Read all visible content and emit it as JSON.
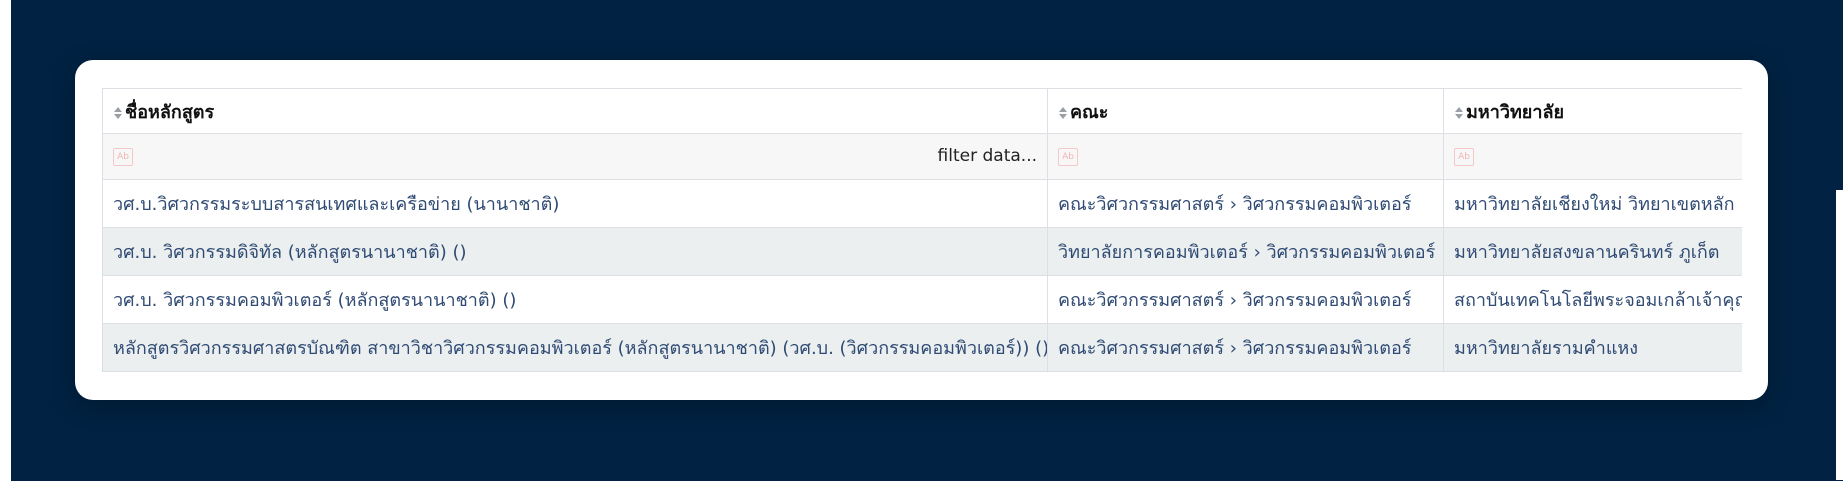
{
  "table": {
    "columns": [
      "ชื่อหลักสูตร",
      "คณะ",
      "มหาวิทยาลัย"
    ],
    "filter_placeholder": "filter data...",
    "filter_icon_text": "Ab",
    "rows": [
      [
        "วศ.บ.วิศวกรรมระบบสารสนเทศและเครือข่าย (นานาชาติ)",
        "คณะวิศวกรรมศาสตร์ › วิศวกรรมคอมพิวเตอร์",
        "มหาวิทยาลัยเชียงใหม่ วิทยาเขตหลัก"
      ],
      [
        "วศ.บ. วิศวกรรมดิจิทัล (หลักสูตรนานาชาติ) ()",
        "วิทยาลัยการคอมพิวเตอร์ › วิศวกรรมคอมพิวเตอร์",
        "มหาวิทยาลัยสงขลานครินทร์ ภูเก็ต"
      ],
      [
        "วศ.บ. วิศวกรรมคอมพิวเตอร์ (หลักสูตรนานาชาติ) ()",
        "คณะวิศวกรรมศาสตร์ › วิศวกรรมคอมพิวเตอร์",
        "สถาบันเทคโนโลยีพระจอมเกล้าเจ้าคุณ"
      ],
      [
        "หลักสูตรวิศวกรรมศาสตรบัณฑิต สาขาวิชาวิศวกรรมคอมพิวเตอร์ (หลักสูตรนานาชาติ) (วศ.บ. (วิศวกรรมคอมพิวเตอร์)) ()",
        "คณะวิศวกรรมศาสตร์ › วิศวกรรมคอมพิวเตอร์",
        "มหาวิทยาลัยรามคำแหง"
      ]
    ]
  },
  "colors": {
    "page_background": "#012242",
    "card_background": "#ffffff",
    "cell_text": "#2f4a73",
    "alt_row": "#ebeff0"
  },
  "icons": [
    "sort-icon",
    "filter-icon"
  ]
}
